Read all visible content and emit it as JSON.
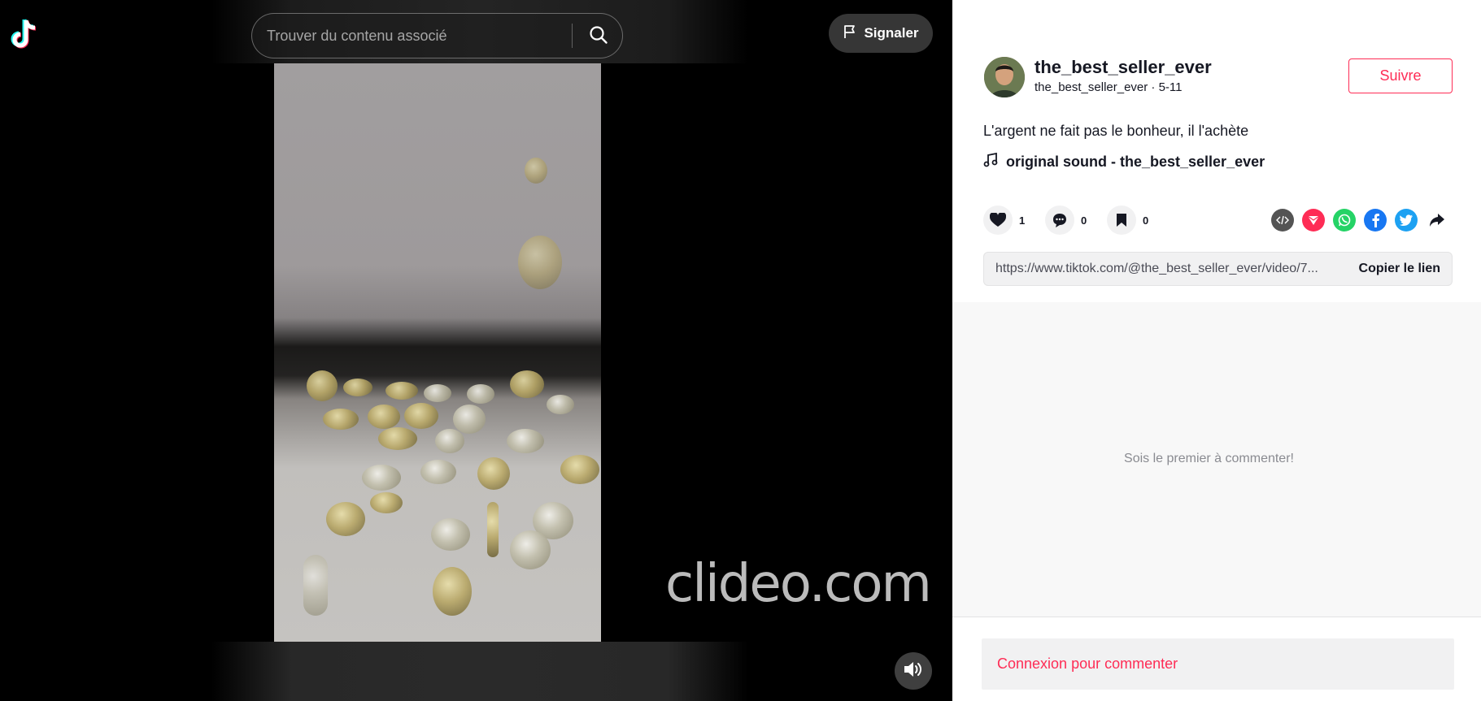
{
  "header": {
    "logo_icon": "tiktok-logo-icon",
    "search": {
      "placeholder": "Trouver du contenu associé",
      "value": "",
      "icon": "search-icon"
    },
    "report": {
      "label": "Signaler",
      "icon": "flag-icon"
    }
  },
  "video": {
    "watermark": "clideo.com",
    "volume_icon": "speaker-icon"
  },
  "author": {
    "display_name": "the_best_seller_ever",
    "subline": "the_best_seller_ever · 5-11",
    "follow_label": "Suivre"
  },
  "post": {
    "description": "L'argent ne fait pas le bonheur, il l'achète",
    "music": "original sound - the_best_seller_ever",
    "music_icon": "music-note-icon"
  },
  "stats": {
    "likes": "1",
    "comments": "0",
    "saves": "0"
  },
  "share": {
    "icons": [
      "embed-icon",
      "send-icon",
      "whatsapp-icon",
      "facebook-icon",
      "twitter-icon",
      "share-arrow-icon"
    ]
  },
  "link": {
    "url": "https://www.tiktok.com/@the_best_seller_ever/video/7...",
    "copy_label": "Copier le lien"
  },
  "comments": {
    "empty_text": "Sois le premier à commenter!"
  },
  "login": {
    "label": "Connexion pour commenter"
  },
  "colors": {
    "accent": "#fe2c55",
    "text": "#161823",
    "panel_bg": "#f8f8f8"
  }
}
